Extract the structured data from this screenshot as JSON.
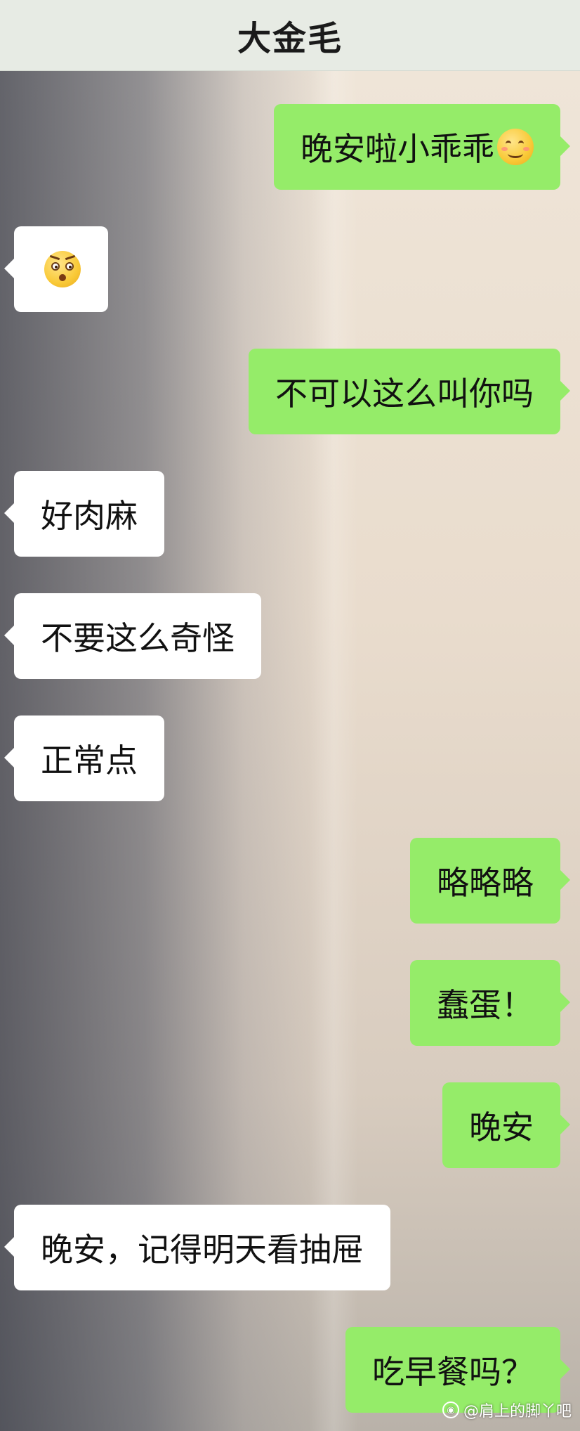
{
  "header": {
    "title": "大金毛"
  },
  "messages": [
    {
      "side": "right",
      "text": "晚安啦小乖乖",
      "emoji": "blush-emoji"
    },
    {
      "side": "left",
      "text": "",
      "emoji": "shocked-emoji"
    },
    {
      "side": "right",
      "text": "不可以这么叫你吗"
    },
    {
      "side": "left",
      "text": "好肉麻"
    },
    {
      "side": "left",
      "text": "不要这么奇怪"
    },
    {
      "side": "left",
      "text": "正常点"
    },
    {
      "side": "right",
      "text": "略略略"
    },
    {
      "side": "right",
      "text": "蠢蛋！"
    },
    {
      "side": "right",
      "text": "晚安"
    },
    {
      "side": "left",
      "text": "晚安，记得明天看抽屉"
    },
    {
      "side": "right",
      "text": "吃早餐吗？"
    }
  ],
  "watermark": {
    "text": "@肩上的脚丫吧",
    "icon": "camera-icon"
  },
  "colors": {
    "sent_bubble": "#95ec69",
    "received_bubble": "#ffffff",
    "header_bg": "#e7ebe4"
  }
}
